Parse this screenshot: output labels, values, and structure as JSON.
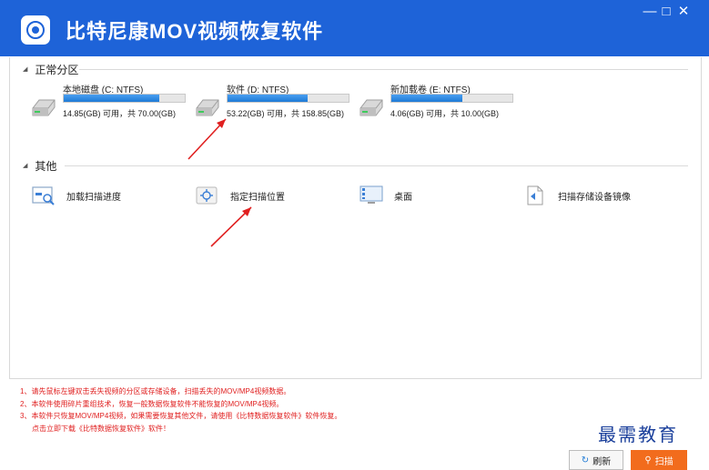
{
  "app": {
    "title": "比特尼康MOV视频恢复软件"
  },
  "window_controls": {
    "minimize": "—",
    "maximize": "□",
    "close": "✕"
  },
  "sections": {
    "normal": {
      "label": "正常分区"
    },
    "other": {
      "label": "其他"
    }
  },
  "drives": [
    {
      "name": "本地磁盘 (C: NTFS)",
      "free_text": "14.85(GB) 可用，共 70.00(GB)",
      "used_fraction": 0.79
    },
    {
      "name": "软件 (D: NTFS)",
      "free_text": "53.22(GB) 可用，共 158.85(GB)",
      "used_fraction": 0.66
    },
    {
      "name": "新加载卷 (E: NTFS)",
      "free_text": "4.06(GB) 可用，共 10.00(GB)",
      "used_fraction": 0.59
    }
  ],
  "others": [
    {
      "label": "加载扫描进度",
      "icon": "load-progress-icon"
    },
    {
      "label": "指定扫描位置",
      "icon": "target-location-icon"
    },
    {
      "label": "桌面",
      "icon": "desktop-icon"
    },
    {
      "label": "扫描存储设备镜像",
      "icon": "disk-image-icon"
    }
  ],
  "notes": [
    "1、请先鼠标左键双击丢失视频的分区或存储设备，扫描丢失的MOV/MP4视频数据。",
    "2、本软件使用碎片重组技术，恢复一般数据恢复软件不能恢复的MOV/MP4视频。",
    "3、本软件只恢复MOV/MP4视频，如果需要恢复其他文件，请使用《比特数据恢复软件》软件恢复。",
    "点击立即下载《比特数据恢复软件》软件！"
  ],
  "buttons": {
    "refresh": "刷新",
    "scan": "扫描"
  },
  "watermark": "最需教育",
  "colors": {
    "titlebar": "#1e63d8",
    "bar_fill": "#1e7ad6",
    "note_text": "#e02020",
    "scan_button": "#f26c1d",
    "arrow": "#e02020"
  }
}
